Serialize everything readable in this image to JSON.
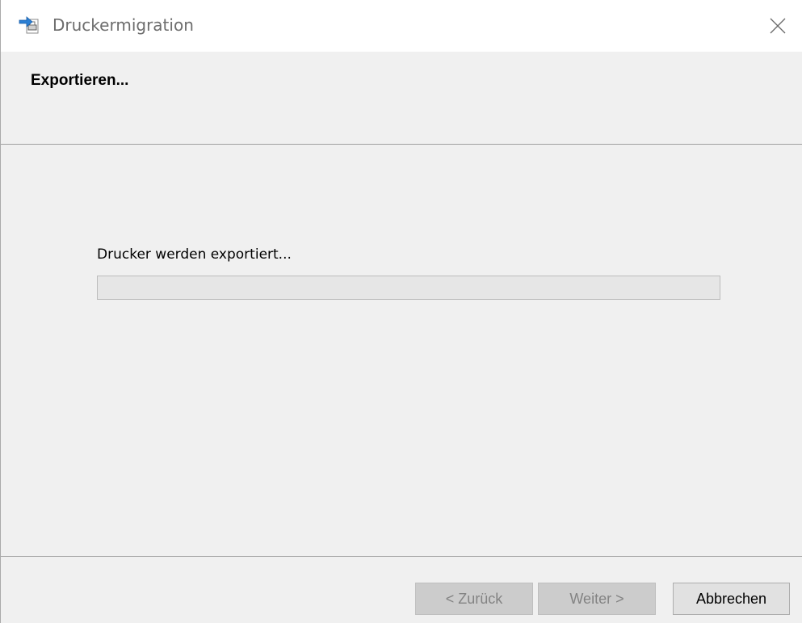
{
  "window": {
    "title": "Druckermigration",
    "icon": "printer-migration-icon"
  },
  "header": {
    "title": "Exportieren..."
  },
  "main": {
    "status_label": "Drucker werden exportiert...",
    "progress_percent": 0
  },
  "footer": {
    "back_label": "< Zurück",
    "next_label": "Weiter >",
    "cancel_label": "Abbrechen"
  },
  "colors": {
    "titlebar_bg": "#ffffff",
    "window_bg": "#f0f0f0",
    "progress_fill": "#06b025"
  }
}
